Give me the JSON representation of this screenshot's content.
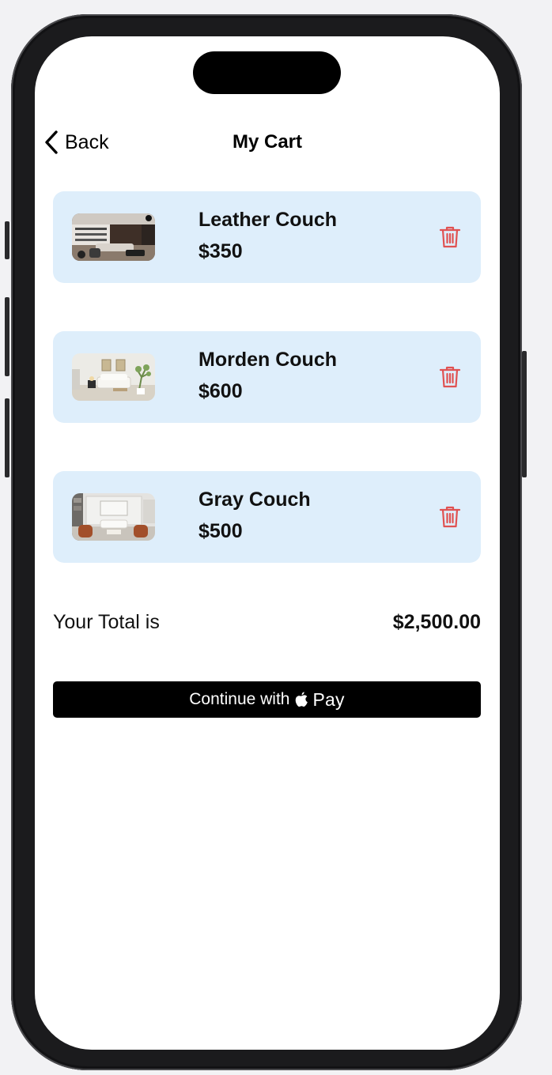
{
  "nav": {
    "back_label": "Back",
    "title": "My Cart"
  },
  "cart": {
    "items": [
      {
        "name": "Leather Couch",
        "price": "$350",
        "thumb_icon": "living-room-dark-photo"
      },
      {
        "name": "Morden Couch",
        "price": "$600",
        "thumb_icon": "living-room-white-photo"
      },
      {
        "name": "Gray Couch",
        "price": "$500",
        "thumb_icon": "living-room-gray-photo"
      }
    ]
  },
  "total": {
    "label": "Your Total is",
    "value": "$2,500.00"
  },
  "payment": {
    "prefix": "Continue with",
    "brand_word": "Pay",
    "brand_icon": "apple-logo-icon"
  },
  "colors": {
    "card_background": "#deeefb",
    "delete_icon": "#e05252",
    "button_background": "#000000"
  }
}
